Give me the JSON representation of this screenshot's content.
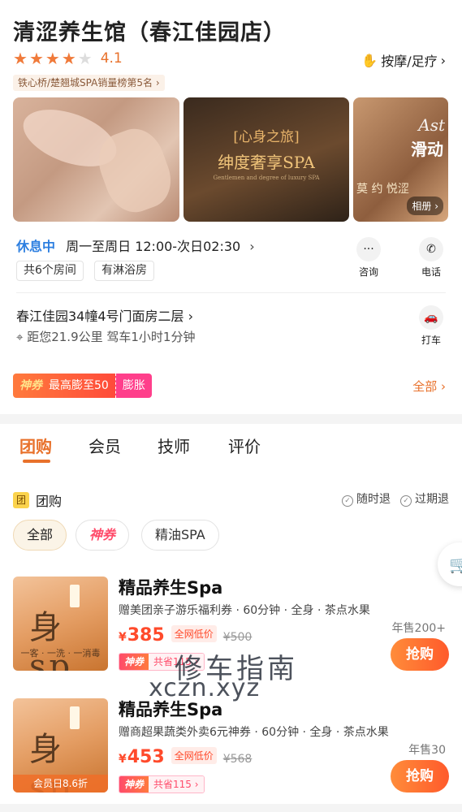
{
  "shop": {
    "title": "清涩养生馆（春江佳园店）",
    "rating": "4.1",
    "stars_filled": 4,
    "stars_total": 5,
    "category": "按摩/足疗",
    "rank": "铁心桥/楚翘城SPA销量榜第5名",
    "album_label": "相册"
  },
  "photos": {
    "p2_line1": "[心身之旅]",
    "p2_line2": "绅度奢享SPA",
    "p2_line3": "Gentlemen and degree of luxury SPA",
    "p3_line1": "Ast",
    "p3_line2": "滑动",
    "p3_line3": "莫 约 悦涩"
  },
  "hours": {
    "status": "休息中",
    "text": "周一至周日 12:00-次日02:30"
  },
  "tags": [
    "共6个房间",
    "有淋浴房"
  ],
  "actions": {
    "consult": "咨询",
    "phone": "电话",
    "taxi": "打车"
  },
  "address": {
    "line": "春江佳园34幢4号门面房二层",
    "distance": "距您21.9公里 驾车1小时1分钟"
  },
  "coupon": {
    "brand": "神券",
    "max": "最高膨至50",
    "expand": "膨胀",
    "all": "全部"
  },
  "tabs": [
    "团购",
    "会员",
    "技师",
    "评价"
  ],
  "groupbuy": {
    "icon_text": "团",
    "label": "团购",
    "refund_any": "随时退",
    "refund_expire": "过期退"
  },
  "filters": [
    "全部",
    "神券",
    "精油SPA"
  ],
  "products": [
    {
      "title": "精品养生Spa",
      "desc": "赠美团亲子游乐福利券 · 60分钟 · 全身 · 茶点水果",
      "sales": "年售200+",
      "price": "385",
      "low_label": "全网低价",
      "orig": "¥500",
      "coupon_brand": "神券",
      "coupon_text": "共省115",
      "thumb_big": "身sp",
      "thumb_small": "一客 · 一洗 · 一消毒",
      "thumb_badge": "",
      "buy": "抢购"
    },
    {
      "title": "精品养生Spa",
      "desc": "赠商超果蔬类外卖6元神券 · 60分钟 · 全身 · 茶点水果",
      "sales": "年售30",
      "price": "453",
      "low_label": "全网低价",
      "orig": "¥568",
      "coupon_brand": "神券",
      "coupon_text": "共省115",
      "thumb_big": "身sp",
      "thumb_small": "",
      "thumb_badge": "会员日8.6折",
      "buy": "抢购"
    }
  ],
  "watermark": {
    "line1": "修车指南",
    "line2": "xczn.xyz"
  },
  "colors": {
    "accent": "#e8712b",
    "price": "#ff4a2b",
    "status": "#2d7fe0",
    "coupon_pink": "#ff3f8b"
  }
}
